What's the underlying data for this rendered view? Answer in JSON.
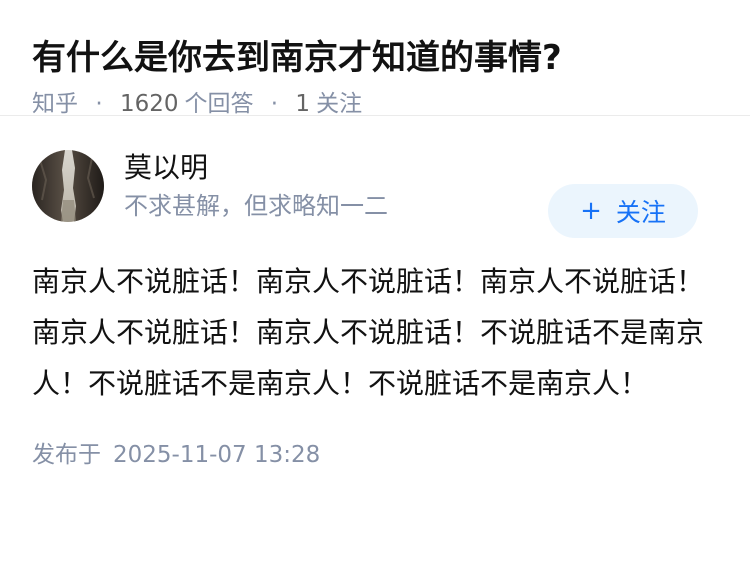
{
  "question": {
    "title": "有什么是你去到南京才知道的事情?",
    "source": "知乎",
    "answer_count": "1620",
    "answer_label": "个回答",
    "follow_count": "1",
    "follow_label": "关注"
  },
  "author": {
    "name": "莫以明",
    "bio": "不求甚解，但求略知一二",
    "follow_button": "关注",
    "follow_icon": "plus-icon"
  },
  "answer": {
    "content": "南京人不说脏话！南京人不说脏话！南京人不说脏话！南京人不说脏话！南京人不说脏话！不说脏话不是南京人！不说脏话不是南京人！不说脏话不是南京人！",
    "publish_label": "发布于",
    "publish_time": "2025-11-07 13:28"
  },
  "colors": {
    "accent": "#1772f6",
    "follow_bg": "#ebf5fd",
    "meta_text": "#8590a6"
  }
}
